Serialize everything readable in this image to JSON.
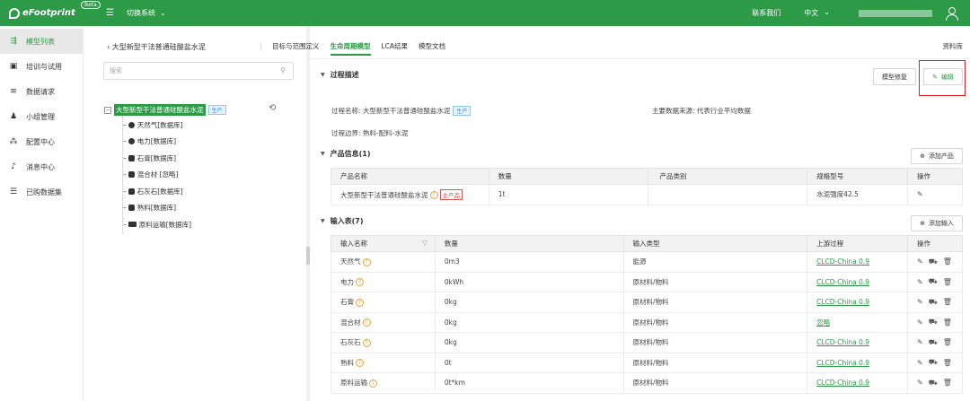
{
  "topbar": {
    "logo": "eFootprint",
    "beta": "Beta",
    "system_switch": "切换系统",
    "contact": "联系我们",
    "language": "中文"
  },
  "leftnav": {
    "items": [
      {
        "label": "模型列表",
        "icon": "model-list-icon",
        "active": true
      },
      {
        "label": "培训与试用",
        "icon": "training-icon",
        "active": false
      },
      {
        "label": "数据请求",
        "icon": "data-request-icon",
        "active": false
      },
      {
        "label": "小组管理",
        "icon": "group-icon",
        "active": false
      },
      {
        "label": "配置中心",
        "icon": "config-icon",
        "active": false
      },
      {
        "label": "消息中心",
        "icon": "bell-icon",
        "active": false
      },
      {
        "label": "已购数据集",
        "icon": "dataset-icon",
        "active": false
      }
    ]
  },
  "tree": {
    "back_title": "大型新型干法普通硅酸盐水泥",
    "search_placeholder": "搜索",
    "root": "大型新型干法普通硅酸盐水泥",
    "root_tag": "生产",
    "children": [
      {
        "label": "天然气[数据库]",
        "icon": "fire-icon"
      },
      {
        "label": "电力[数据库]",
        "icon": "fire-icon"
      },
      {
        "label": "石膏[数据库]",
        "icon": "database-icon"
      },
      {
        "label": "混合材 [忽略]",
        "icon": "database-icon"
      },
      {
        "label": "石灰石[数据库]",
        "icon": "database-icon"
      },
      {
        "label": "熟料[数据库]",
        "icon": "database-icon"
      },
      {
        "label": "原料运输[数据库]",
        "icon": "truck-icon"
      }
    ]
  },
  "tabs": {
    "items": [
      "目标与范围定义",
      "生命周期模型",
      "LCA结果",
      "模型文档"
    ],
    "active": "生命周期模型",
    "library": "资料库"
  },
  "process": {
    "title": "过程描述",
    "repair_btn": "模型修复",
    "edit_btn": "编辑",
    "name_label": "过程名称: 大型新型干法普通硅酸盐水泥",
    "name_tag": "生产",
    "source": "主要数据来源: 代表行业平均数据",
    "boundary": "过程边界: 熟料-配料-水泥"
  },
  "products": {
    "title": "产品信息(1)",
    "add_btn": "添加产品",
    "headers": [
      "产品名称",
      "数量",
      "产品类别",
      "规格型号",
      "操作"
    ],
    "rows": [
      {
        "name": "大型新型干法普通硅酸盐水泥",
        "tag": "主产品",
        "qty": "1t",
        "category": "",
        "spec": "水泥强度42.5"
      }
    ]
  },
  "inputs": {
    "title": "输入表(7)",
    "add_btn": "添加输入",
    "headers": [
      "输入名称",
      "数量",
      "输入类型",
      "上游过程",
      "操作"
    ],
    "rows": [
      {
        "name": "天然气",
        "qty": "0m3",
        "type": "能源",
        "upstream": "CLCD-China 0.9"
      },
      {
        "name": "电力",
        "qty": "0kWh",
        "type": "原材料/物料",
        "upstream": "CLCD-China 0.9"
      },
      {
        "name": "石膏",
        "qty": "0kg",
        "type": "原材料/物料",
        "upstream": "CLCD-China 0.9"
      },
      {
        "name": "混合材",
        "qty": "0kg",
        "type": "原材料/物料",
        "upstream": "忽略"
      },
      {
        "name": "石灰石",
        "qty": "0kg",
        "type": "原材料/物料",
        "upstream": "CLCD-China 0.9"
      },
      {
        "name": "熟料",
        "qty": "0t",
        "type": "原材料/物料",
        "upstream": "CLCD-China 0.9"
      },
      {
        "name": "原料运输",
        "qty": "0t*km",
        "type": "原材料/物料",
        "upstream": "CLCD-China 0.9"
      }
    ]
  },
  "colors": {
    "brand": "#2c9a47",
    "highlight": "#e02020"
  }
}
